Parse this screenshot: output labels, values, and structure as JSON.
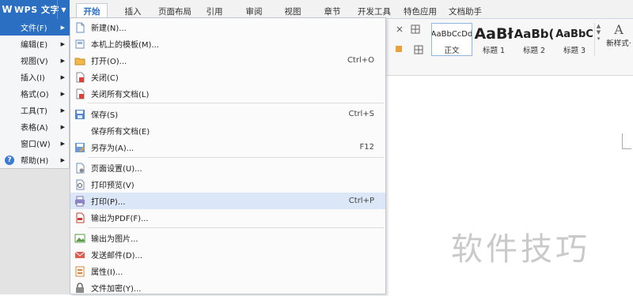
{
  "app": {
    "logo": "W",
    "title": "WPS 文字",
    "menu_arrow": "▼"
  },
  "tabs": [
    {
      "label": "开始",
      "active": true
    },
    {
      "label": "插入"
    },
    {
      "label": "页面布局"
    },
    {
      "label": "引用"
    },
    {
      "label": "审阅"
    },
    {
      "label": "视图"
    },
    {
      "label": "章节"
    },
    {
      "label": "开发工具"
    },
    {
      "label": "特色应用"
    },
    {
      "label": "文档助手"
    }
  ],
  "styles": [
    {
      "sample": "AaBbCcDd",
      "name": "正文"
    },
    {
      "sample": "AaBł",
      "name": "标题 1"
    },
    {
      "sample": "AaBb(",
      "name": "标题 2"
    },
    {
      "sample": "AaBbC",
      "name": "标题 3"
    }
  ],
  "new_style": {
    "icon": "A",
    "label": "新样式·"
  },
  "main_menu": [
    {
      "label": "文件(F)",
      "active": true
    },
    {
      "label": "编辑(E)"
    },
    {
      "label": "视图(V)"
    },
    {
      "label": "插入(I)"
    },
    {
      "label": "格式(O)"
    },
    {
      "label": "工具(T)"
    },
    {
      "label": "表格(A)"
    },
    {
      "label": "窗口(W)"
    },
    {
      "label": "帮助(H)"
    }
  ],
  "file_menu": [
    {
      "label": "新建(N)...",
      "shortcut": "",
      "icon": "new-doc-icon"
    },
    {
      "label": "本机上的模板(M)...",
      "shortcut": "",
      "icon": "template-icon"
    },
    {
      "label": "打开(O)...",
      "shortcut": "Ctrl+O",
      "icon": "folder-open-icon"
    },
    {
      "label": "关闭(C)",
      "shortcut": "",
      "icon": "close-doc-icon"
    },
    {
      "label": "关闭所有文档(L)",
      "shortcut": "",
      "icon": "close-all-icon"
    },
    {
      "label": "保存(S)",
      "shortcut": "Ctrl+S",
      "icon": "save-icon"
    },
    {
      "label": "保存所有文档(E)",
      "shortcut": "",
      "icon": ""
    },
    {
      "label": "另存为(A)...",
      "shortcut": "F12",
      "icon": "save-as-icon"
    },
    {
      "label": "页面设置(U)...",
      "shortcut": "",
      "icon": "page-setup-icon"
    },
    {
      "label": "打印预览(V)",
      "shortcut": "",
      "icon": "print-preview-icon"
    },
    {
      "label": "打印(P)...",
      "shortcut": "Ctrl+P",
      "icon": "printer-icon",
      "hover": true
    },
    {
      "label": "输出为PDF(F)...",
      "shortcut": "",
      "icon": "pdf-icon"
    },
    {
      "label": "输出为图片...",
      "shortcut": "",
      "icon": "image-export-icon"
    },
    {
      "label": "发送邮件(D)...",
      "shortcut": "",
      "icon": "mail-icon"
    },
    {
      "label": "属性(I)...",
      "shortcut": "",
      "icon": "properties-icon"
    },
    {
      "label": "文件加密(Y)...",
      "shortcut": "",
      "icon": "encrypt-icon"
    }
  ],
  "watermark": "软件技巧",
  "colors": {
    "accent": "#2a6fc2",
    "hover": "#dbe6f6",
    "menu_bg": "#fbfbfb"
  }
}
